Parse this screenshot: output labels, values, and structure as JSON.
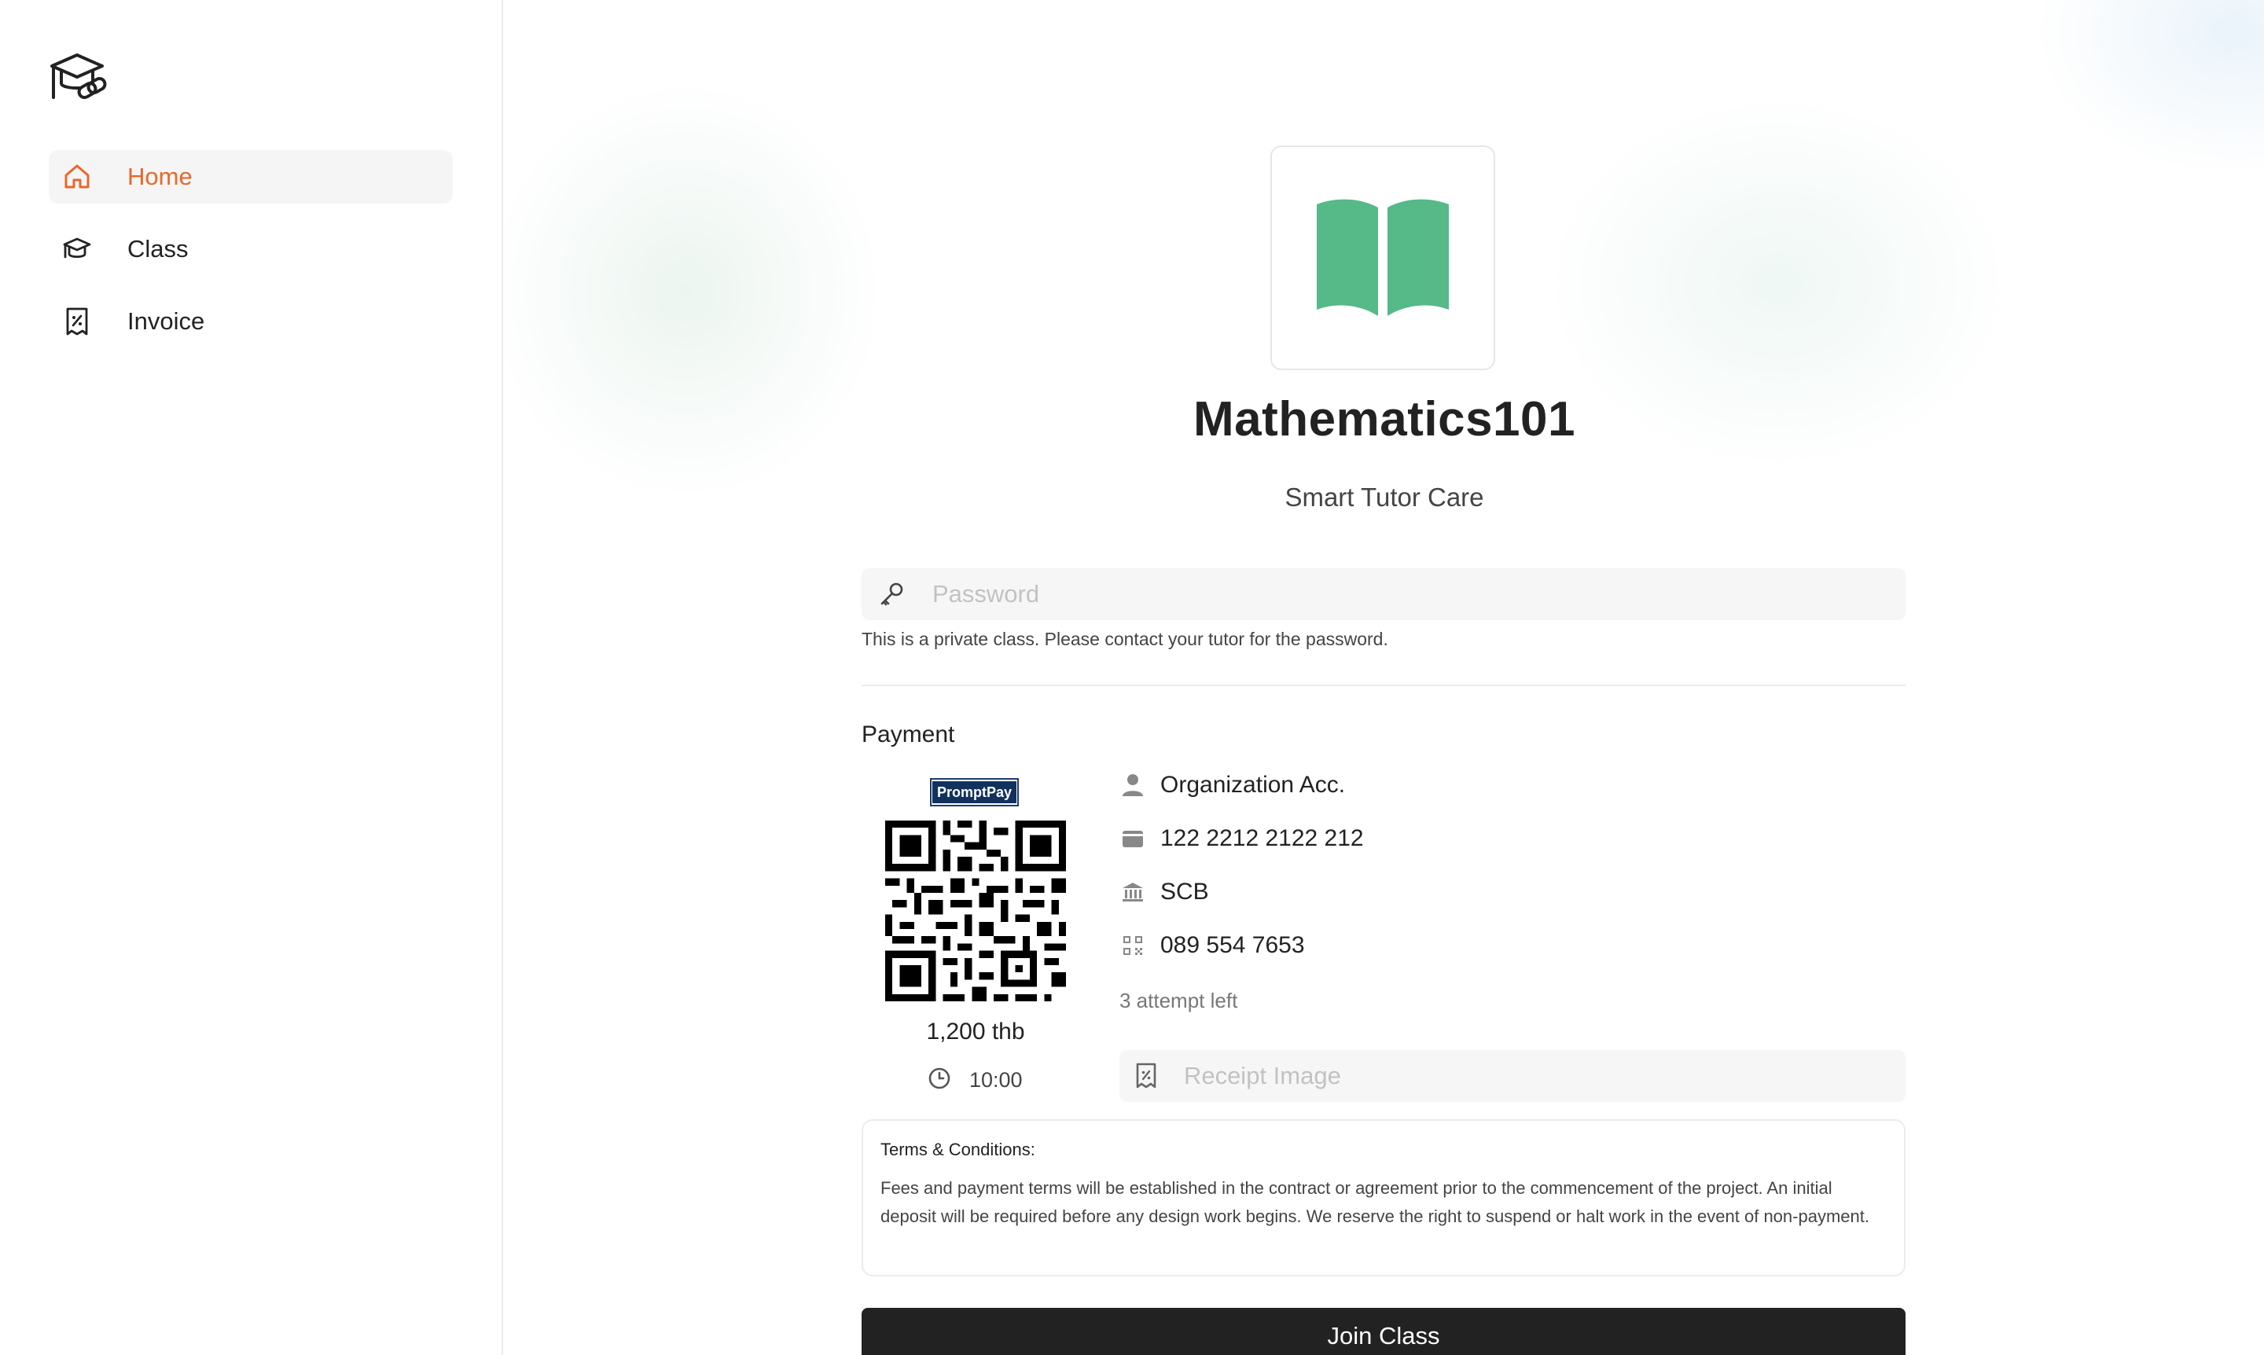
{
  "sidebar": {
    "logo_icon": "graduation-cap-link-icon",
    "items": [
      {
        "label": "Home",
        "icon": "home-icon",
        "active": true
      },
      {
        "label": "Class",
        "icon": "graduation-cap-icon",
        "active": false
      },
      {
        "label": "Invoice",
        "icon": "receipt-icon",
        "active": false
      }
    ]
  },
  "class": {
    "icon": "open-book-icon",
    "title": "Mathematics101",
    "organization": "Smart Tutor Care"
  },
  "password": {
    "placeholder": "Password",
    "value": "",
    "hint": "This is a private class. Please contact your tutor for the password."
  },
  "payment": {
    "heading": "Payment",
    "promptpay_label": "PromptPay",
    "amount": "1,200 thb",
    "timer": "10:00",
    "account_name": "Organization Acc.",
    "account_number": "122 2212 2122 212",
    "bank": "SCB",
    "promptpay_number": "089 554 7653",
    "attempts": "3 attempt left",
    "receipt_placeholder": "Receipt Image"
  },
  "terms": {
    "heading": "Terms & Conditions:",
    "body": "Fees and payment terms will be established in the contract or agreement prior to the commencement of the project. An initial deposit will be required before any design work begins. We reserve the right to suspend or halt work in the event of non-payment."
  },
  "join_label": "Join Class",
  "colors": {
    "accent": "#e8682a",
    "book": "#55b988",
    "button": "#222222"
  }
}
